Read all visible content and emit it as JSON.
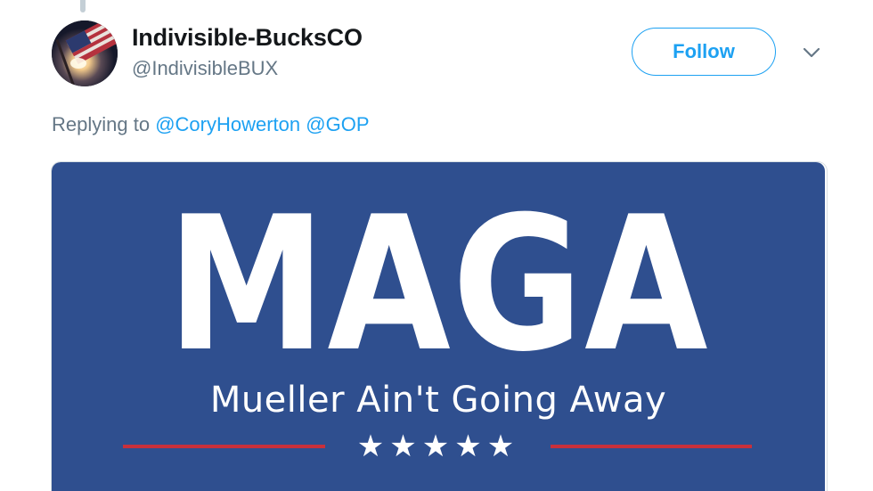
{
  "tweet": {
    "author": {
      "display_name": "Indivisible-BucksCO",
      "handle": "@IndivisibleBUX",
      "avatar_icon": "flag-sunset-avatar"
    },
    "follow_label": "Follow",
    "menu_icon": "chevron-down-icon",
    "reply": {
      "prefix": "Replying to",
      "mentions": [
        "@CoryHowerton",
        "@GOP"
      ]
    },
    "media": {
      "headline": "MAGA",
      "tagline": "Mueller Ain't Going Away",
      "stars": "★★★★★",
      "colors": {
        "background": "#2f4f8f",
        "stripe": "#c8303b",
        "text": "#ffffff"
      }
    }
  },
  "colors": {
    "accent": "#1da1f2",
    "secondary_text": "#657786",
    "primary_text": "#14171a"
  }
}
